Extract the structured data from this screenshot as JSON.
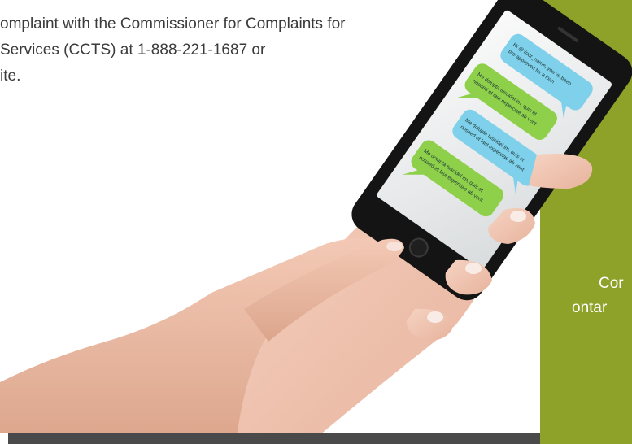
{
  "body_text": {
    "line1": "omplaint with the Commissioner for Complaints for",
    "line2": "Services (CCTS) at 1-888-221-1687 or",
    "line3": "ite."
  },
  "green_panel": {
    "line1": "Cor",
    "line2": "ontar"
  },
  "phone_messages": [
    {
      "color": "blue",
      "line1": "Hi @Your_name, you've been",
      "line2": "pre-approved for a loan"
    },
    {
      "color": "green",
      "line1": "Me dolupta tuscidel im, quis et",
      "line2": "nosaed et laut experciae ab vent"
    },
    {
      "color": "blue",
      "line1": "Me dolupta tuscidel im, quis et",
      "line2": "nosaed et laut experciae ab vent"
    },
    {
      "color": "green",
      "line1": "Me dolupta tuscidel im, quis et",
      "line2": "nosaed et laut experciae ab vent"
    }
  ],
  "colors": {
    "panel_green": "#8ea229",
    "bubble_blue": "#7fd0ea",
    "bubble_green": "#8fd04a",
    "text_gray": "#3a3a3a"
  }
}
